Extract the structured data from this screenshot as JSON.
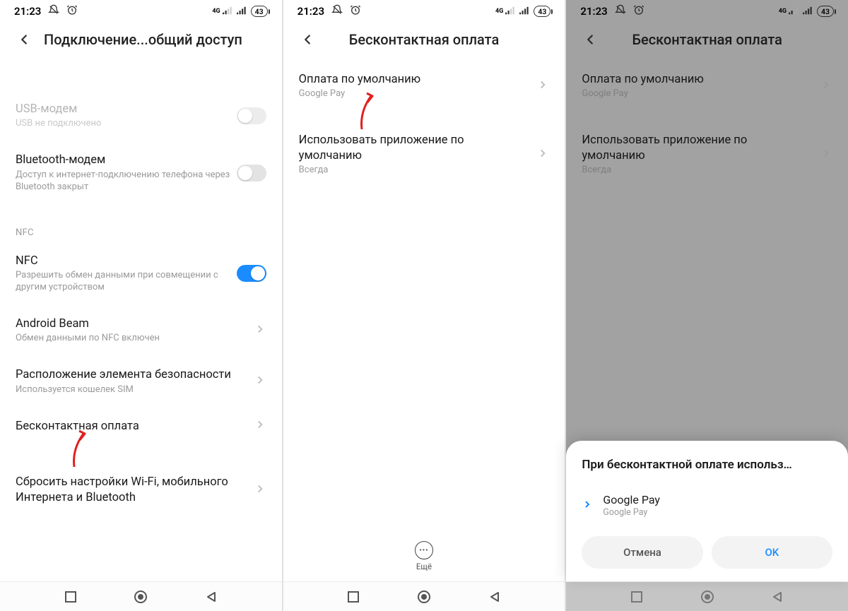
{
  "status": {
    "time": "21:23",
    "battery": "43",
    "net": "4G"
  },
  "screen1": {
    "title": "Подключение...общий доступ",
    "usb": {
      "title": "USB-модем",
      "sub": "USB не подключено"
    },
    "bt": {
      "title": "Bluetooth-модем",
      "sub": "Доступ к интернет-подключению телефона через Bluetooth закрыт"
    },
    "nfc_section": "NFC",
    "nfc": {
      "title": "NFC",
      "sub": "Разрешить обмен данными при совмещении с другим устройством"
    },
    "beam": {
      "title": "Android Beam",
      "sub": "Обмен данными по NFC включен"
    },
    "secure": {
      "title": "Расположение элемента безопасности",
      "sub": "Используется кошелек SIM"
    },
    "contactless": {
      "title": "Бесконтактная оплата"
    },
    "reset": {
      "title": "Сбросить настройки Wi-Fi, мобильного Интернета и Bluetooth"
    }
  },
  "screen2": {
    "title": "Бесконтактная оплата",
    "default_pay": {
      "title": "Оплата по умолчанию",
      "sub": "Google Pay"
    },
    "use_default": {
      "title": "Использовать приложение по умолчанию",
      "sub": "Всегда"
    },
    "more": "Ещё"
  },
  "screen3": {
    "title": "Бесконтактная оплата",
    "default_pay": {
      "title": "Оплата по умолчанию",
      "sub": "Google Pay"
    },
    "use_default": {
      "title": "Использовать приложение по умолчанию",
      "sub": "Всегда"
    },
    "dialog": {
      "title": "При бесконтактной оплате использ…",
      "option": {
        "title": "Google Pay",
        "sub": "Google Pay"
      },
      "cancel": "Отмена",
      "ok": "OK"
    }
  }
}
